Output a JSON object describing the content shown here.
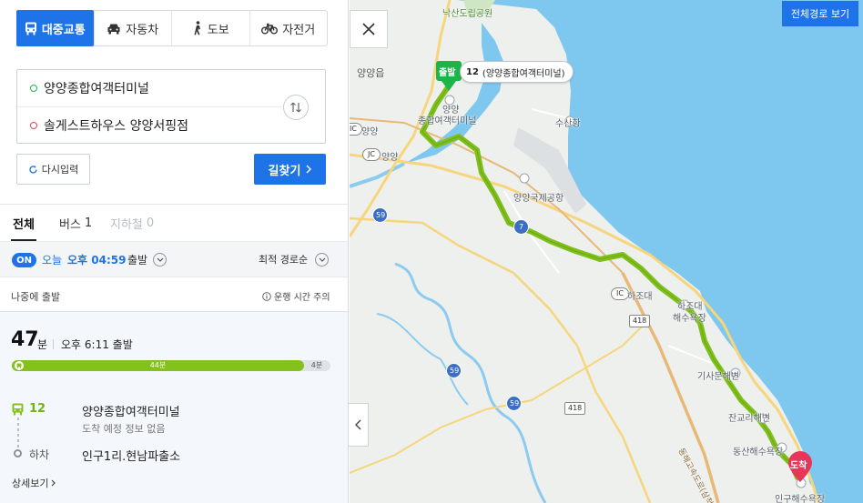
{
  "modes": [
    {
      "label": "대중교통",
      "icon": "bus-icon",
      "active": true
    },
    {
      "label": "자동차",
      "icon": "car-icon",
      "active": false
    },
    {
      "label": "도보",
      "icon": "walk-icon",
      "active": false
    },
    {
      "label": "자전거",
      "icon": "bicycle-icon",
      "active": false
    }
  ],
  "route": {
    "origin": "양양종합여객터미널",
    "destination": "솔게스트하우스 양양서핑점",
    "reset_label": "다시입력",
    "search_label": "길찾기"
  },
  "tabs": [
    {
      "label": "전체",
      "count": ""
    },
    {
      "label": "버스",
      "count": "1"
    },
    {
      "label": "지하철",
      "count": "0"
    }
  ],
  "departure": {
    "toggle": "ON",
    "day": "오늘",
    "time": "오후 04:59",
    "suffix": "출발",
    "sort": "최적 경로순",
    "later": "나중에 출발",
    "notice": "운행 시간 주의"
  },
  "result": {
    "duration": "47",
    "duration_unit": "분",
    "arrival": "오후 6:11 출발",
    "bar": {
      "ride": "44분",
      "walk": "4분",
      "ride_fraction": 0.917
    },
    "bus_number": "12",
    "board_stop": "양양종합여객터미널",
    "board_sub": "도착 예정 정보 없음",
    "alight_label": "하차",
    "alight_stop": "인구1리.현남파출소",
    "detail": "상세보기"
  },
  "map": {
    "full_route": "전체경로 보기",
    "start_badge": "출발",
    "start_bus": "12",
    "start_name": "(양양종합여객터미널)",
    "end_badge": "도착",
    "labels": {
      "park": "낙산도립공원",
      "yangyang_eup": "양양읍",
      "terminal_a": "양양",
      "terminal_b": "종합여객터미널",
      "susan": "수산항",
      "ic_yangyang": "양양",
      "jc_yangyang": "양양",
      "airport": "양양국제공항",
      "hajodae_ic": "하조대",
      "hajodae_beach_a": "하조대",
      "hajodae_beach_b": "해수욕장",
      "gisamun": "기사문해변",
      "jangyeol": "잔교리해변",
      "dongsan": "동산해수욕장",
      "ingu": "인구해수욕장",
      "expressway": "동해고속도로(삼척-속초)"
    },
    "shields": {
      "r59a": "59",
      "r59b": "59",
      "r59c": "59",
      "r7": "7",
      "r418a": "418",
      "r418b": "418",
      "ic": "IC",
      "jc": "JC"
    }
  }
}
